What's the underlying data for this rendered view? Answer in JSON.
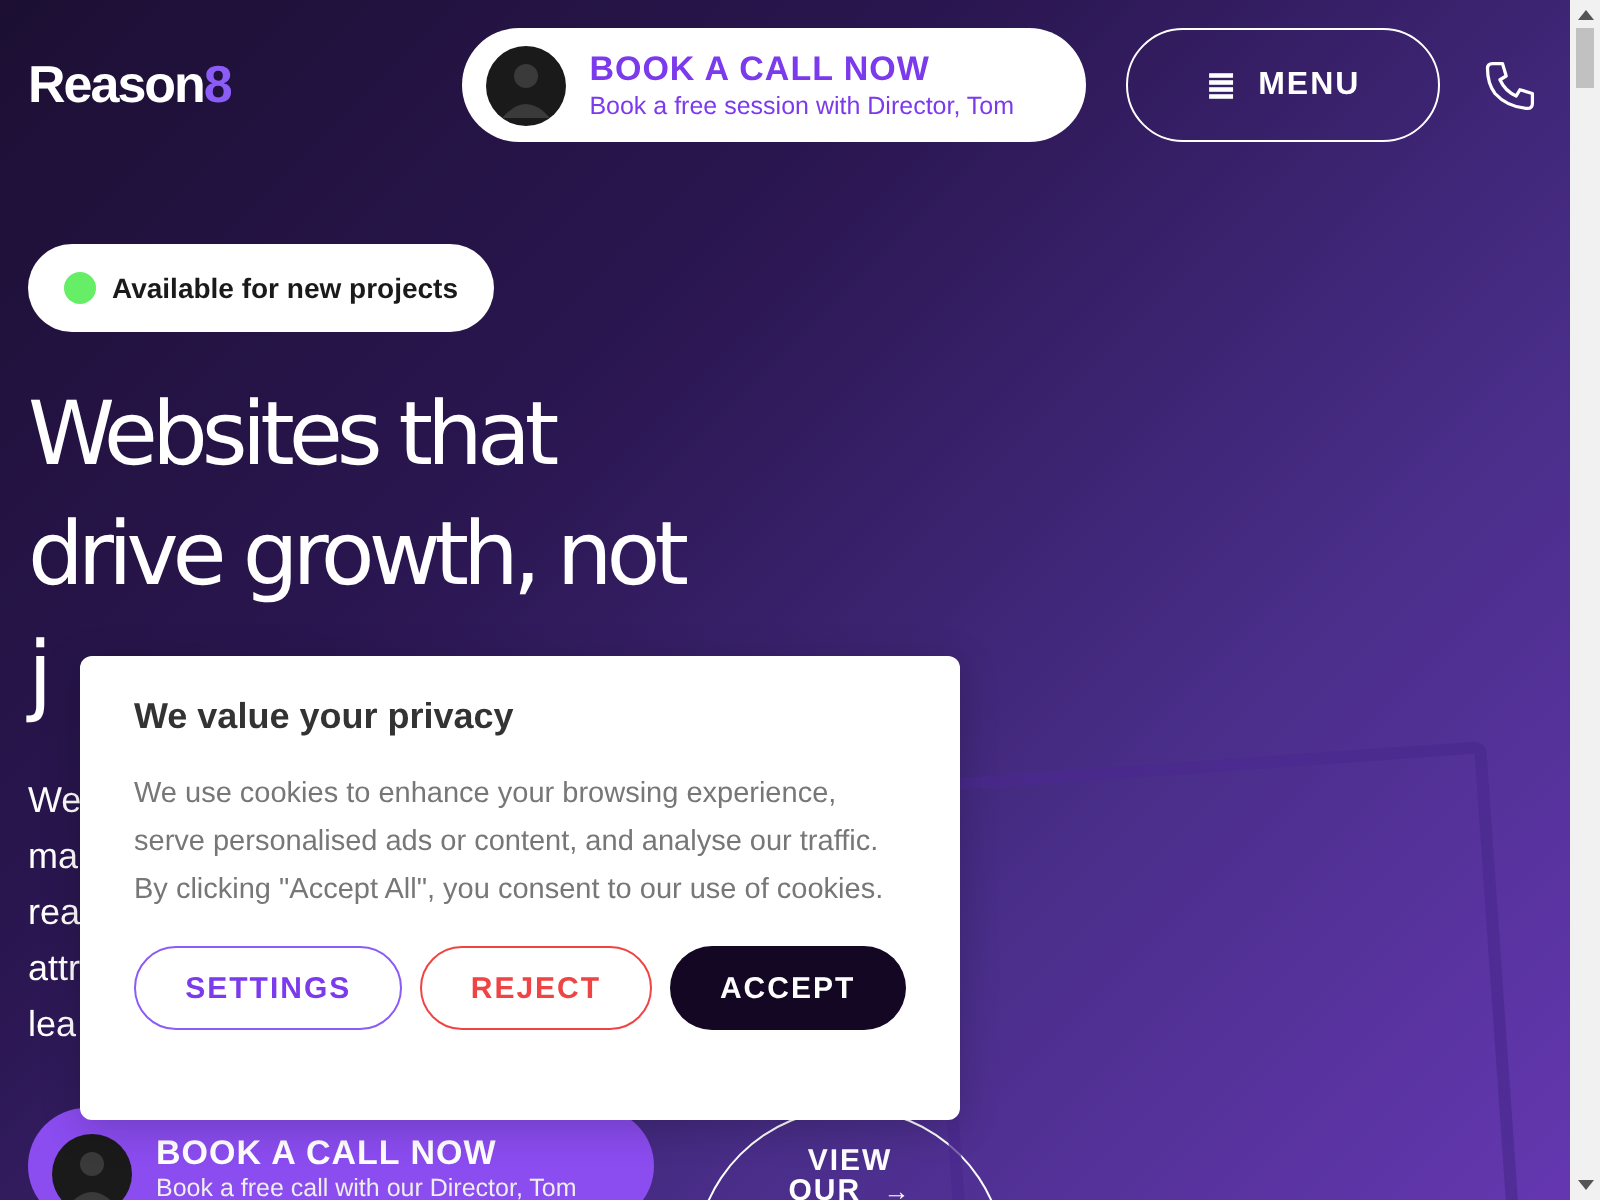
{
  "header": {
    "logo": {
      "name": "Reason",
      "accent": "8"
    },
    "call_button": {
      "title": "BOOK A CALL NOW",
      "subtitle": "Book a free session with Director, Tom"
    },
    "menu_button": {
      "icon": "≣",
      "label": "MENU"
    }
  },
  "hero": {
    "status": {
      "label": "Available for new projects",
      "color": "#66ee66"
    },
    "headline": [
      "Websites that",
      "drive growth, not",
      "j"
    ],
    "paragraph": [
      "We",
      "ma",
      "rea",
      "attr",
      "lea"
    ],
    "call_button": {
      "title": "BOOK A CALL NOW",
      "subtitle": "Book a free call with our Director, Tom"
    },
    "view_button": {
      "lines": [
        "VIEW",
        "OUR"
      ],
      "arrow": "→"
    }
  },
  "cookie_dialog": {
    "title": "We value your privacy",
    "text": "We use cookies to enhance your browsing experience, serve personalised ads or content, and analyse our traffic. By clicking \"Accept All\", you consent to our use of cookies.",
    "buttons": [
      {
        "label": "SETTINGS",
        "kind": "outline"
      },
      {
        "label": "REJECT",
        "kind": "danger"
      },
      {
        "label": "ACCEPT",
        "kind": "primary"
      }
    ]
  }
}
